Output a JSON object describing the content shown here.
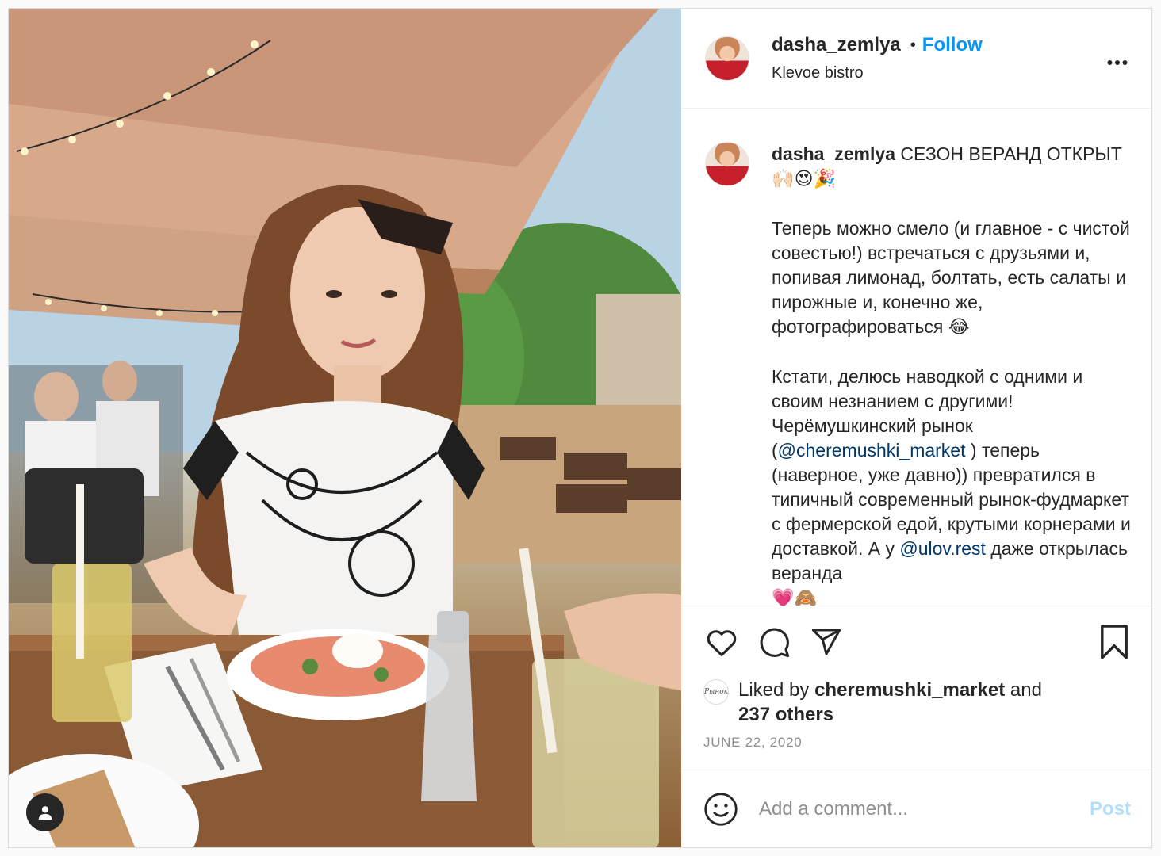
{
  "post": {
    "photo": {
      "alt_icon": "user-tag-icon"
    },
    "header": {
      "username": "dasha_zemlya",
      "separator": "•",
      "follow_label": "Follow",
      "location": "Klevoe bistro",
      "more_label": "•••"
    },
    "caption": {
      "username": "dasha_zemlya",
      "line1": " СЕЗОН ВЕРАНД ОТКРЫТ ",
      "line1_emojis": "🙌🏻😍🎉",
      "para2": "Теперь можно смело (и главное - с чистой совестью!) встречаться с друзьями и, попивая лимонад, болтать, есть салаты и пирожные и, конечно же, фотографироваться ",
      "para2_emoji": "😂",
      "para3_a": "Кстати, делюсь наводкой с одними и своим незнанием с другими! Черёмушкинский рынок (",
      "mention1": "@cheremushki_market",
      "para3_b": " ) теперь (наверное, уже давно)) превратился в типичный современный рынок-фудмаркет с фермерской едой, крутыми корнерами и доставкой. А у ",
      "mention2": "@ulov.rest",
      "para3_c": " даже открылась веранда",
      "para3_emojis": "💗🙈"
    },
    "actions": {
      "like_icon": "heart-icon",
      "comment_icon": "comment-icon",
      "share_icon": "share-icon",
      "save_icon": "bookmark-icon"
    },
    "likes": {
      "prefix": "Liked by ",
      "user": "cheremushki_market",
      "middle": " and",
      "count_text": "237 others",
      "avatar_text": "Рынок"
    },
    "date": "JUNE 22, 2020",
    "add_comment": {
      "placeholder": "Add a comment...",
      "post_label": "Post"
    },
    "colors": {
      "link_blue": "#0095f6",
      "mention_blue": "#00376b",
      "post_disabled": "#b2dffc",
      "secondary_text": "#8e8e8e"
    }
  }
}
